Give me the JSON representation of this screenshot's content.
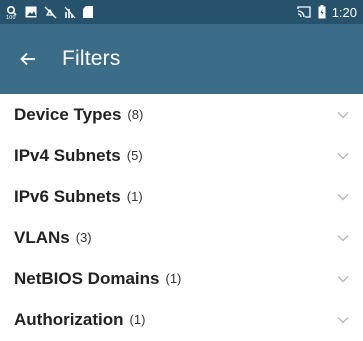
{
  "status_bar": {
    "time": "1:20",
    "left_icons": [
      "notification-icon",
      "image-icon",
      "mute-icon",
      "signal-off-icon",
      "sd-card-icon"
    ],
    "right_icons": [
      "cast-icon",
      "battery-icon"
    ]
  },
  "app_bar": {
    "title": "Filters",
    "back_icon": "arrow-left-icon"
  },
  "filters": [
    {
      "label": "Device Types",
      "count": "(8)"
    },
    {
      "label": "IPv4 Subnets",
      "count": "(5)"
    },
    {
      "label": "IPv6 Subnets",
      "count": "(1)"
    },
    {
      "label": "VLANs",
      "count": "(3)"
    },
    {
      "label": "NetBIOS Domains",
      "count": "(1)"
    },
    {
      "label": "Authorization",
      "count": "(1)"
    }
  ],
  "colors": {
    "status_bar": "#27526c",
    "app_bar": "#3b6c88",
    "chevron": "#b8b8b8"
  }
}
